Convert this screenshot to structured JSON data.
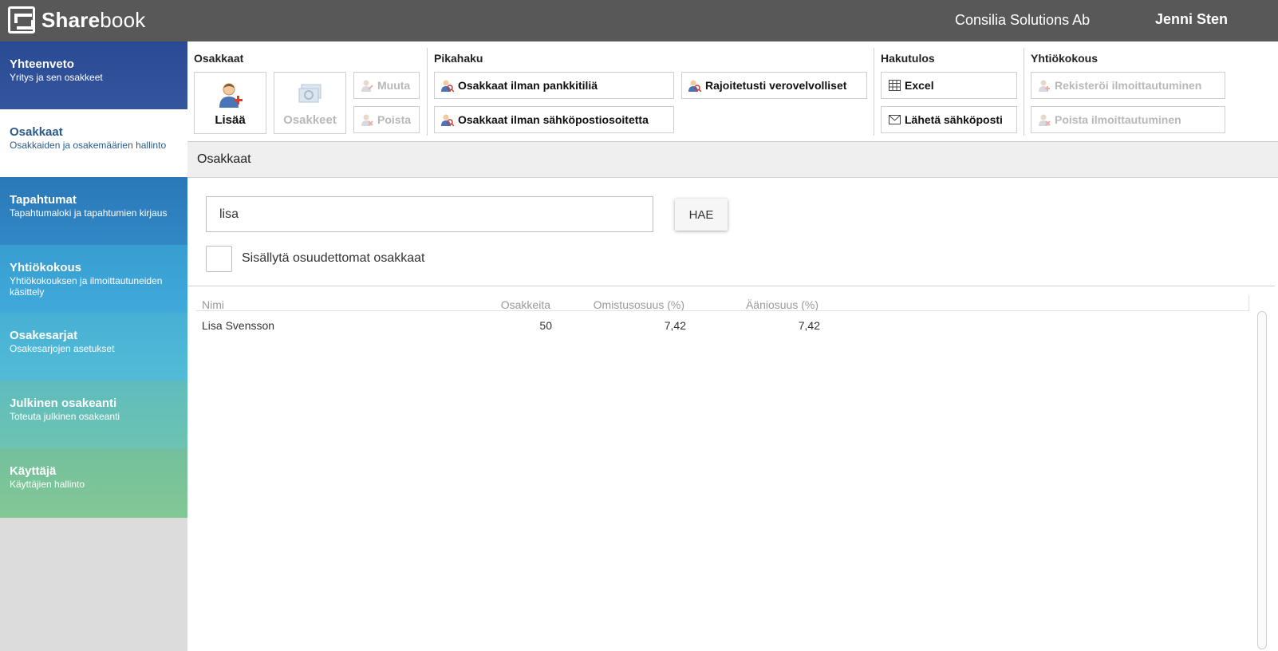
{
  "header": {
    "logo_bold": "Share",
    "logo_light": "book",
    "company": "Consilia Solutions Ab",
    "user": "Jenni Sten"
  },
  "sidebar": {
    "items": [
      {
        "title": "Yhteenveto",
        "subtitle": "Yritys ja sen osakkeet",
        "color": "#2c4e9a",
        "active": false
      },
      {
        "title": "Osakkaat",
        "subtitle": "Osakkaiden ja osakemäärien hallinto",
        "color": "#ffffff",
        "active": true
      },
      {
        "title": "Tapahtumat",
        "subtitle": "Tapahtumaloki ja tapahtumien kirjaus",
        "color": "#2f82c0",
        "active": false
      },
      {
        "title": "Yhtiökokous",
        "subtitle": "Yhtiökokouksen ja ilmoittautuneiden käsittely",
        "color": "#3aa5d6",
        "active": false
      },
      {
        "title": "Osakesarjat",
        "subtitle": "Osakesarjojen asetukset",
        "color": "#4db7d6",
        "active": false
      },
      {
        "title": "Julkinen osakeanti",
        "subtitle": "Toteuta julkinen osakeanti",
        "color": "#69c2b5",
        "active": false
      },
      {
        "title": "Käyttäjä",
        "subtitle": "Käyttäjien hallinto",
        "color": "#7cc493",
        "active": false
      }
    ]
  },
  "toolbar": {
    "groups": {
      "osakkaat": "Osakkaat",
      "pikahaku": "Pikahaku",
      "hakutulos": "Hakutulos",
      "yhtiokokous": "Yhtiökokous"
    },
    "add_label": "Lisää",
    "shares_label": "Osakkeet",
    "edit_label": "Muuta",
    "delete_label": "Poista",
    "no_bank_label": "Osakkaat ilman pankkitiliä",
    "limited_tax_label": "Rajoitetusti verovelvolliset",
    "no_email_label": "Osakkaat ilman sähköpostiosoitetta",
    "excel_label": "Excel",
    "send_email_label": "Lähetä sähköposti",
    "register_label": "Rekisteröi ilmoittautuminen",
    "remove_register_label": "Poista ilmoittautuminen"
  },
  "section": {
    "title": "Osakkaat"
  },
  "search": {
    "value": "lisa",
    "button_label": "HAE",
    "checkbox_label": "Sisällytä osuudettomat osakkaat",
    "checked": false
  },
  "table": {
    "columns": [
      "Nimi",
      "Osakkeita",
      "Omistusosuus (%)",
      "Ääniosuus (%)"
    ],
    "rows": [
      {
        "name": "Lisa Svensson",
        "shares": "50",
        "ownership": "7,42",
        "votes": "7,42"
      }
    ]
  }
}
